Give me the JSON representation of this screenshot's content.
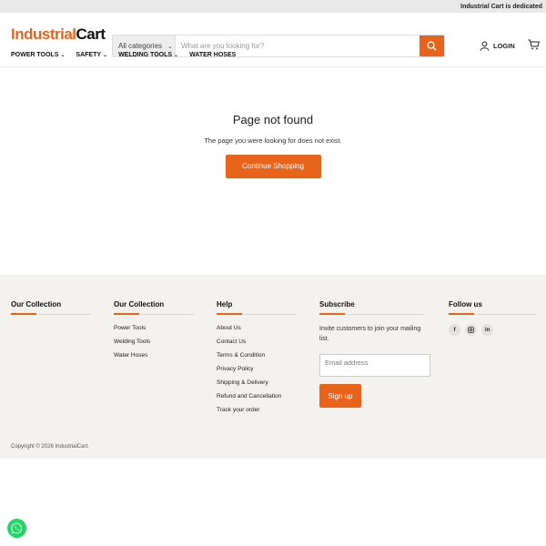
{
  "announcement": "Industrial Cart is dedicated",
  "logo": {
    "part1": "Industrial",
    "part2": "Cart"
  },
  "search": {
    "category": "All categories",
    "placeholder": "What are you looking for?"
  },
  "account": {
    "login_label": "LOGIN"
  },
  "nav": {
    "items": [
      {
        "label": "POWER TOOLS",
        "has_dropdown": true
      },
      {
        "label": "SAFETY",
        "has_dropdown": true
      },
      {
        "label": "WELDING TOOLS",
        "has_dropdown": true
      },
      {
        "label": "WATER HOSES",
        "has_dropdown": false
      }
    ]
  },
  "main": {
    "title": "Page not found",
    "message": "The page you were looking for does not exist.",
    "cta": "Continue Shopping"
  },
  "footer": {
    "col1": {
      "title": "Our Collection"
    },
    "col2": {
      "title": "Our Collection",
      "links": [
        "Power Tools",
        "Welding Tools",
        "Water Hoses"
      ]
    },
    "col3": {
      "title": "Help",
      "links": [
        "About Us",
        "Contact Us",
        "Terms & Condition",
        "Privacy Policy",
        "Shipping & Delivery",
        "Refund and Cancellation",
        "Track your order"
      ]
    },
    "subscribe": {
      "title": "Subscribe",
      "text": "Invite customers to join your mailing list.",
      "email_placeholder": "Email address",
      "button": "Sign up"
    },
    "follow": {
      "title": "Follow us",
      "icons": [
        "facebook-icon",
        "instagram-icon",
        "linkedin-icon"
      ]
    },
    "copyright": "Copyright © 2026 IndustrialCart."
  },
  "colors": {
    "accent": "#e8641b",
    "footer_bg": "#f3f2ee",
    "whatsapp": "#25d366"
  }
}
